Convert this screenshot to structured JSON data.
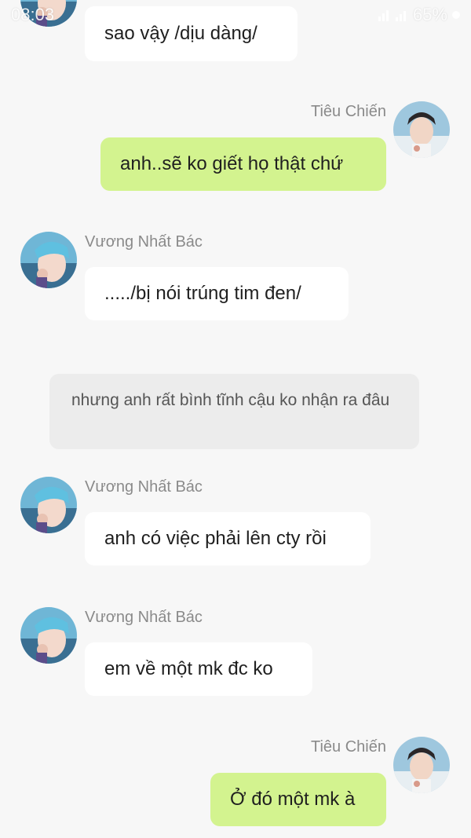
{
  "status_bar": {
    "time": "08:03",
    "time_suffix": "Ⓕ",
    "battery": "65%"
  },
  "colors": {
    "background": "#f7f7f7",
    "bubble_self": "#d3f38f",
    "bubble_other": "#ffffff",
    "narration": "#ececec",
    "name_text": "#8a8a8a"
  },
  "messages": [
    {
      "side": "left",
      "sender": "",
      "text": "sao vậy /dịu dàng/"
    },
    {
      "side": "right",
      "sender": "Tiêu Chiến",
      "text": "anh..sẽ ko giết họ thật chứ"
    },
    {
      "side": "left",
      "sender": "Vương Nhất Bác",
      "text": "...../bị nói trúng tim đen/"
    },
    {
      "side": "narration",
      "text": "nhưng anh rất bình tĩnh cậu ko nhận ra đâu"
    },
    {
      "side": "left",
      "sender": "Vương Nhất Bác",
      "text": "anh có việc phải lên cty rồi"
    },
    {
      "side": "left",
      "sender": "Vương Nhất Bác",
      "text": "em về một mk đc ko"
    },
    {
      "side": "right",
      "sender": "Tiêu Chiến",
      "text": "Ở đó một mk à"
    }
  ]
}
